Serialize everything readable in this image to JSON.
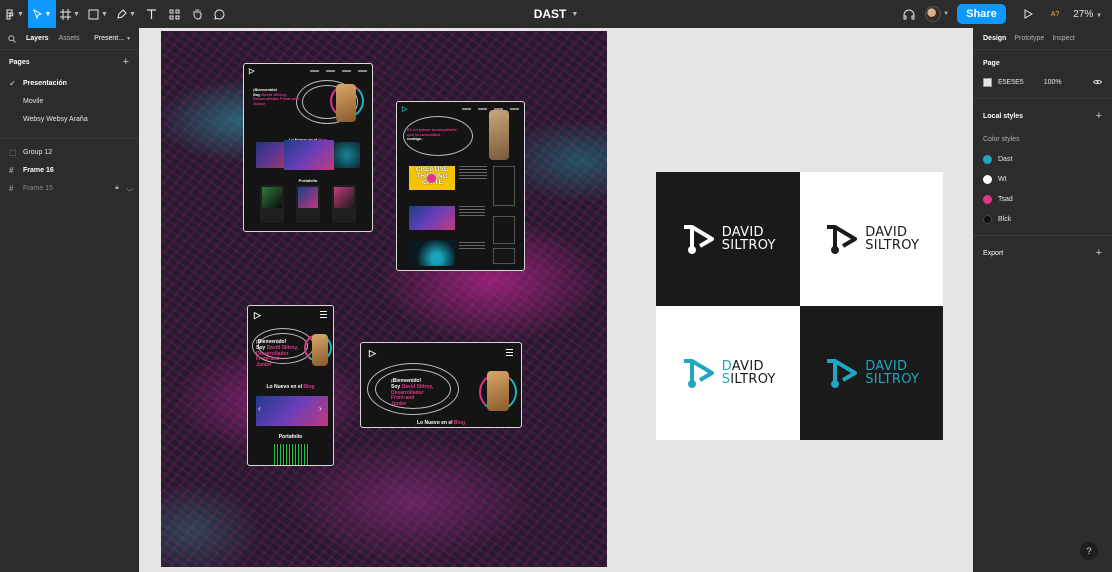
{
  "toolbar": {
    "title": "DAST",
    "share_label": "Share",
    "zoom": "27%",
    "ai_label": "A?"
  },
  "left_panel": {
    "tab_layers": "Layers",
    "tab_assets": "Assets",
    "page_switch": "Present...",
    "pages_title": "Pages",
    "pages": [
      {
        "label": "Presentación"
      },
      {
        "label": "Movile"
      },
      {
        "label": "Websy Websy Araña"
      }
    ],
    "layers": [
      {
        "label": "Group 12"
      },
      {
        "label": "Frame 16"
      },
      {
        "label": "Frame 15"
      }
    ]
  },
  "right_panel": {
    "tab_design": "Design",
    "tab_prototype": "Prototype",
    "tab_inspect": "Inspect",
    "page_title": "Page",
    "page_color": "E5E5E5",
    "page_opacity": "100%",
    "local_styles_title": "Local styles",
    "color_styles_label": "Color styles",
    "color_styles": [
      {
        "label": "Dast",
        "color": "#1fa7c0"
      },
      {
        "label": "Wt",
        "color": "#ffffff"
      },
      {
        "label": "Tsad",
        "color": "#e2338a"
      },
      {
        "label": "Blck",
        "color": "#111111"
      }
    ],
    "export_title": "Export",
    "help": "?"
  },
  "mockups": {
    "desktop1": {
      "hero_line1": "¡Bienvenido!",
      "hero_line2a": "Soy ",
      "hero_line2b": "David Siltroy,",
      "hero_line3": "Desarrollador Front-and",
      "hero_line4": "Junior",
      "blog_title_a": "Lo Nuevo en el ",
      "blog_title_b": "Blog",
      "portfolio_title": "Portafolio"
    },
    "desktop2": {
      "hero_line1a": "Es un placer acompañarte",
      "hero_line2a": "que la curiosidad ",
      "hero_line3": "contigo.",
      "yellow_text": "CREATIVE THINKING IGNITE"
    },
    "mobile": {
      "hero_line1": "¡Bienvenido!",
      "hero_line2a": "Soy ",
      "hero_line2b": "David Siltroy,",
      "hero_line3": "Desarrollador",
      "hero_line4": "Front-and",
      "hero_line5": "Junior",
      "blog_a": "Lo Nuevo en el ",
      "blog_b": "Blog",
      "portfolio": "Portafolio"
    },
    "tablet": {
      "hero_line1": "¡Bienvenido!",
      "hero_line2a": "Soy ",
      "hero_line2b": "David Siltroy,",
      "hero_line3": "Desarrollador",
      "hero_line4": "Front-and",
      "hero_line5": "Junior",
      "blog_a": "Lo Nuevo en el ",
      "blog_b": "Blog"
    }
  },
  "logos": {
    "line1": "DAVID",
    "line2": "SILTROY",
    "accent_first1": "D",
    "accent_rest1": "AVID",
    "accent_first2": "S",
    "accent_rest2": "ILTROY",
    "colors": {
      "dark": "#1a1a1a",
      "light": "#ffffff",
      "accent": "#1fa7c0"
    }
  }
}
